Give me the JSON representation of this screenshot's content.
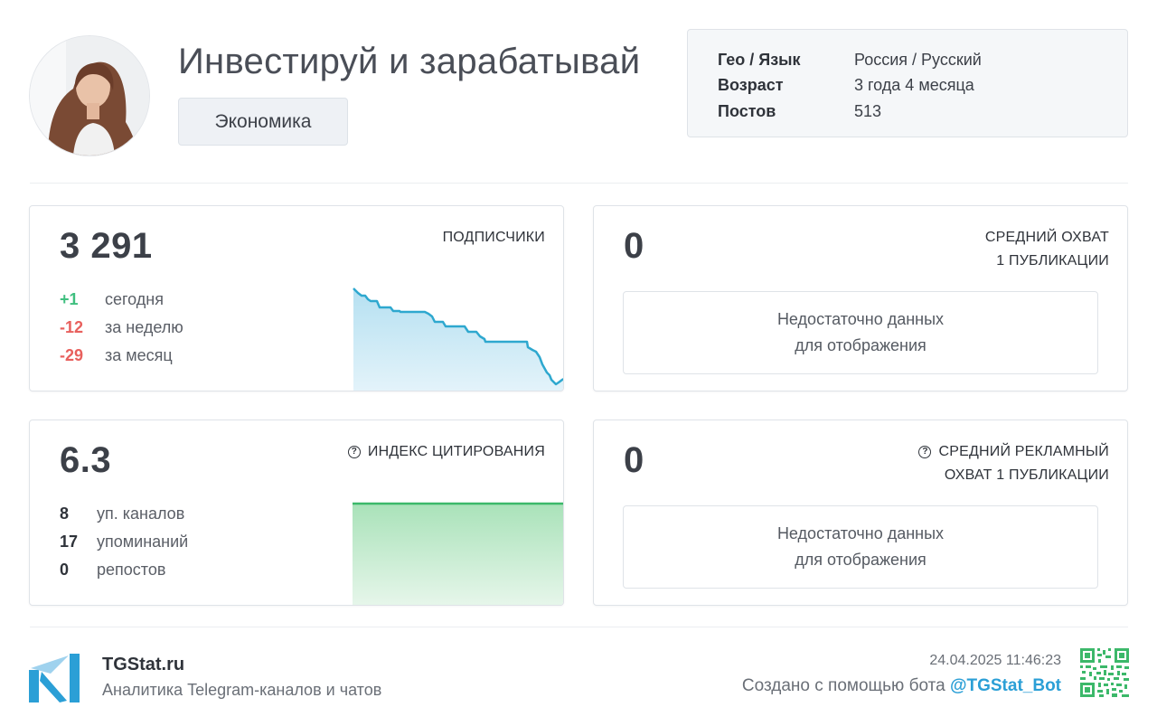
{
  "channel": {
    "title": "Инвестируй и зарабатывай",
    "category": "Экономика"
  },
  "info": [
    {
      "key": "Гео / Язык",
      "value": "Россия / Русский"
    },
    {
      "key": "Возраст",
      "value": "3 года 4 месяца"
    },
    {
      "key": "Постов",
      "value": "513"
    }
  ],
  "subscribers": {
    "value": "3 291",
    "label": "ПОДПИСЧИКИ",
    "stats": [
      {
        "delta": "+1",
        "label": "сегодня",
        "trend": "positive"
      },
      {
        "delta": "-12",
        "label": "за неделю",
        "trend": "negative"
      },
      {
        "delta": "-29",
        "label": "за месяц",
        "trend": "negative"
      }
    ],
    "color": "#2ea8cf"
  },
  "avg_reach": {
    "value": "0",
    "label_line1": "СРЕДНИЙ ОХВАТ",
    "label_line2": "1 ПУБЛИКАЦИИ",
    "nodata_line1": "Недостаточно данных",
    "nodata_line2": "для отображения"
  },
  "citation": {
    "value": "6.3",
    "label": "ИНДЕКС ЦИТИРОВАНИЯ",
    "stats": [
      {
        "num": "8",
        "label": "уп. каналов"
      },
      {
        "num": "17",
        "label": "упоминаний"
      },
      {
        "num": "0",
        "label": "репостов"
      }
    ],
    "color": "#3cb86a"
  },
  "ad_reach": {
    "value": "0",
    "label_line1": "СРЕДНИЙ РЕКЛАМНЫЙ",
    "label_line2": "ОХВАТ 1 ПУБЛИКАЦИИ",
    "nodata_line1": "Недостаточно данных",
    "nodata_line2": "для отображения"
  },
  "footer": {
    "brand": "TGStat.ru",
    "tagline": "Аналитика Telegram-каналов и чатов",
    "timestamp": "24.04.2025 11:46:23",
    "created_prefix": "Создано с помощью бота ",
    "bot": "@TGStat_Bot",
    "brand_color": "#2b9fd6"
  },
  "icons": {
    "help": "question-circle-icon",
    "logo": "tgstat-logo-icon",
    "qr": "qr-code-icon"
  }
}
